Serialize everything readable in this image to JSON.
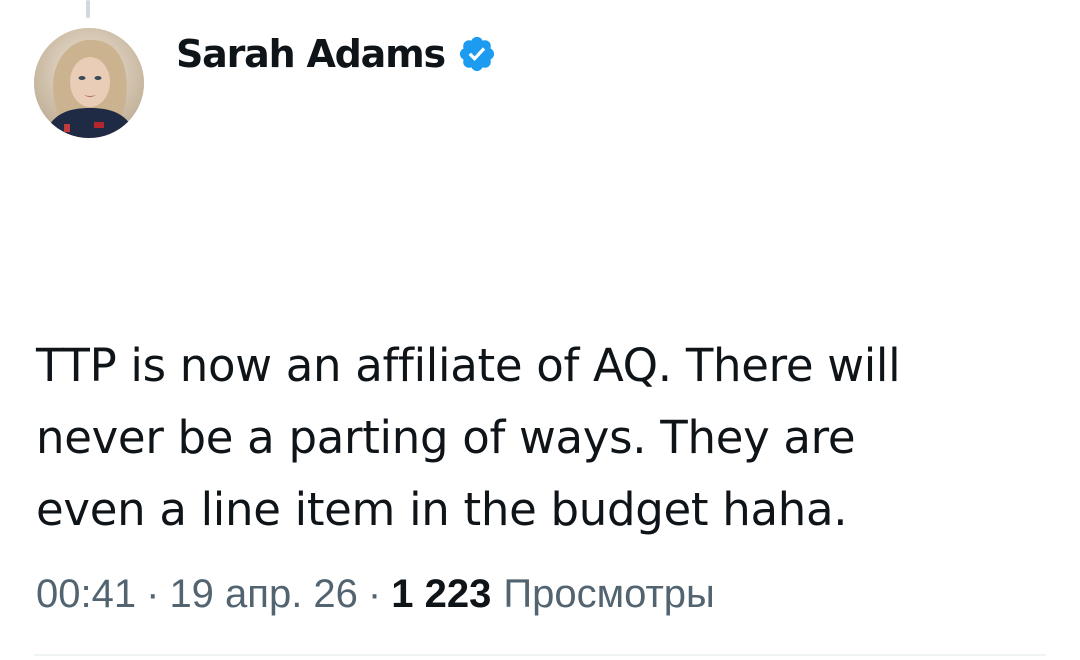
{
  "author": {
    "display_name": "Sarah Adams",
    "verified": true,
    "verified_color": "#1d9bf0",
    "avatar_icon": "profile-photo"
  },
  "tweet": {
    "text": "TTP is now an affiliate of AQ. There will\nnever be a parting of ways. They are\neven a line item in the budget haha."
  },
  "meta": {
    "time": "00:41",
    "separator": "·",
    "date": "19 апр. 26",
    "views_count": "1 223",
    "views_label": "Просмотры"
  },
  "colors": {
    "text_primary": "#0f1419",
    "text_secondary": "#536471",
    "divider": "#eff3f4"
  }
}
